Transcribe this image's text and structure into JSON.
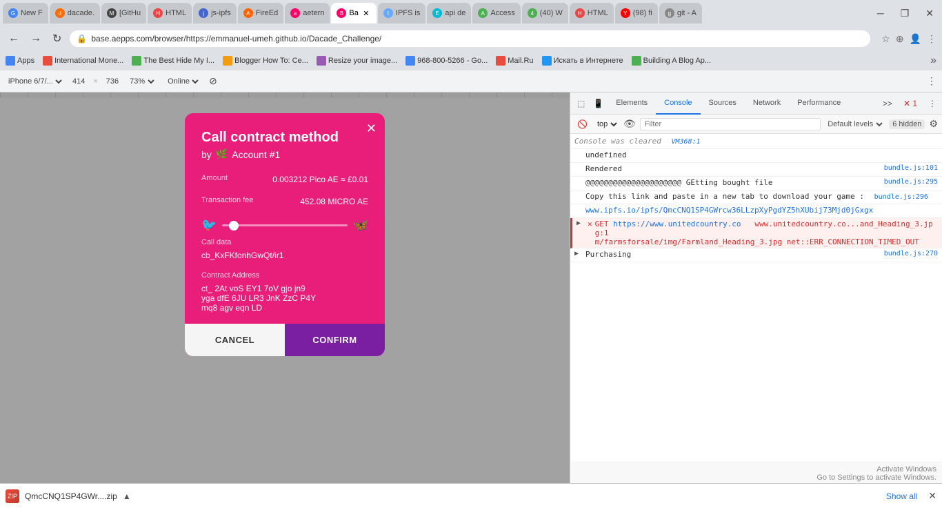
{
  "tabs": [
    {
      "id": "new-tab",
      "label": "New F",
      "favicon_color": "#4285f4",
      "favicon_text": "G",
      "active": false
    },
    {
      "id": "dacade",
      "label": "dacade.",
      "favicon_color": "#ff6b00",
      "favicon_text": "d",
      "active": false
    },
    {
      "id": "github",
      "label": "[GitHu",
      "favicon_color": "#444",
      "favicon_text": "M",
      "active": false
    },
    {
      "id": "html",
      "label": "HTML",
      "favicon_color": "#e44",
      "favicon_text": "H",
      "active": false
    },
    {
      "id": "js-ipfs",
      "label": "js-ipfs",
      "favicon_color": "#4466cc",
      "favicon_text": "j",
      "active": false
    },
    {
      "id": "fireditor",
      "label": "FireEd",
      "favicon_color": "#f60",
      "favicon_text": "A",
      "active": false
    },
    {
      "id": "aeternity",
      "label": "aetern",
      "favicon_color": "#f06",
      "favicon_text": "a",
      "active": false
    },
    {
      "id": "base-active",
      "label": "Ba",
      "favicon_color": "#f06",
      "favicon_text": "B",
      "active": true
    },
    {
      "id": "ipfs-is",
      "label": "IPFS is",
      "favicon_color": "#66aaff",
      "favicon_text": "I",
      "active": false
    },
    {
      "id": "api-de",
      "label": "api de",
      "favicon_color": "#00bcd4",
      "favicon_text": "E",
      "active": false
    },
    {
      "id": "access",
      "label": "Access",
      "favicon_color": "#4caf50",
      "favicon_text": "A",
      "active": false
    },
    {
      "id": "wp40",
      "label": "(40) W",
      "favicon_color": "#4caf50",
      "favicon_text": "4",
      "active": false
    },
    {
      "id": "html2",
      "label": "HTML",
      "favicon_color": "#e44",
      "favicon_text": "H",
      "active": false
    },
    {
      "id": "youtube",
      "label": "(98) fi",
      "favicon_color": "#f00",
      "favicon_text": "Y",
      "active": false
    },
    {
      "id": "git-a",
      "label": "git - A",
      "favicon_color": "#888",
      "favicon_text": "g",
      "active": false
    }
  ],
  "address_bar": {
    "url": "base.aepps.com/browser/https://emmanuel-umeh.github.io/Dacade_Challenge/"
  },
  "bookmarks": [
    {
      "label": "Apps",
      "color": "#4285f4"
    },
    {
      "label": "International Mone...",
      "color": "#e74c3c"
    },
    {
      "label": "The Best Hide My I...",
      "color": "#4CAF50"
    },
    {
      "label": "Blogger How To: Ce...",
      "color": "#f39c12"
    },
    {
      "label": "Resize your image...",
      "color": "#9b59b6"
    },
    {
      "label": "968-800-5266 - Go...",
      "color": "#4285f4"
    },
    {
      "label": "Mail.Ru",
      "color": "#e74c3c"
    },
    {
      "label": "Искать в Интернете",
      "color": "#2196F3"
    },
    {
      "label": "Building A Blog Ap...",
      "color": "#4CAF50"
    }
  ],
  "device_bar": {
    "device": "iPhone 6/7/...",
    "width": "414",
    "x": "×",
    "height": "736",
    "zoom": "73%",
    "network": "Online"
  },
  "modal": {
    "title": "Call contract method",
    "subtitle": "by",
    "account": "Account #1",
    "plant_icon": "🌿",
    "amount_label": "Amount",
    "amount_value": "0.003212 Pico AE ≈ £0.01",
    "fee_label": "Transaction fee",
    "fee_value": "452.08 MICRO AE",
    "call_data_label": "Call data",
    "call_data_value": "cb_KxFKfonhGwQt/ir1",
    "contract_address_label": "Contract Address",
    "contract_address_value": "ct_ 2At voS EY1 7oV gjo jn9\nyga dfE 6JU LR3 JnK ZzC P4Y\nmq8 agv eqn LD",
    "cancel_label": "CANCEL",
    "confirm_label": "CONFIRM",
    "slider_left_icon": "🐦",
    "slider_right_icon": "🦋"
  },
  "devtools": {
    "tabs": [
      "Elements",
      "Console",
      "Sources",
      "Network",
      "Performance"
    ],
    "active_tab": "Console",
    "top_context": "top",
    "filter_placeholder": "Filter",
    "levels_label": "Default levels",
    "hidden_count": "6 hidden",
    "console_lines": [
      {
        "type": "info",
        "text": "Console was cleared",
        "source": "VM368:1",
        "expandable": false
      },
      {
        "type": "normal",
        "text": "undefined",
        "source": "",
        "expandable": false
      },
      {
        "type": "normal",
        "text": "Rendered",
        "source": "bundle.js:101",
        "expandable": false
      },
      {
        "type": "normal",
        "text": "@@@@@@@@@@@@@@@@@@@@@ GEtting bought file",
        "source": "bundle.js:295",
        "expandable": false
      },
      {
        "type": "normal",
        "text": "Copy this link and paste in a new tab to download your game :",
        "source": "bundle.js:296",
        "expandable": false
      },
      {
        "type": "link",
        "text": "www.ipfs.io/ipfs/QmcCNQ1SP4GWrcw36LLzpXyPgdYZ5hXUbij73Mjd0jGxgx",
        "source": "",
        "expandable": false
      },
      {
        "type": "error",
        "text": "GET https://www.unitedcountry.co  www.unitedcountry.co...and_Heading_3.jpg:1\nm/farmsforsale/img/Farmland_Heading_3.jpg net::ERR_CONNECTION_TIMED_OUT",
        "source": "",
        "expandable": true
      },
      {
        "type": "normal",
        "text": "Purchasing",
        "source": "bundle.js:270",
        "expandable": true
      }
    ]
  },
  "download": {
    "filename": "QmcCNQ1SP4GWr....zip",
    "show_all": "Show all"
  },
  "activate_windows": {
    "line1": "Activate Windows",
    "line2": "Go to Settings to activate Windows."
  }
}
